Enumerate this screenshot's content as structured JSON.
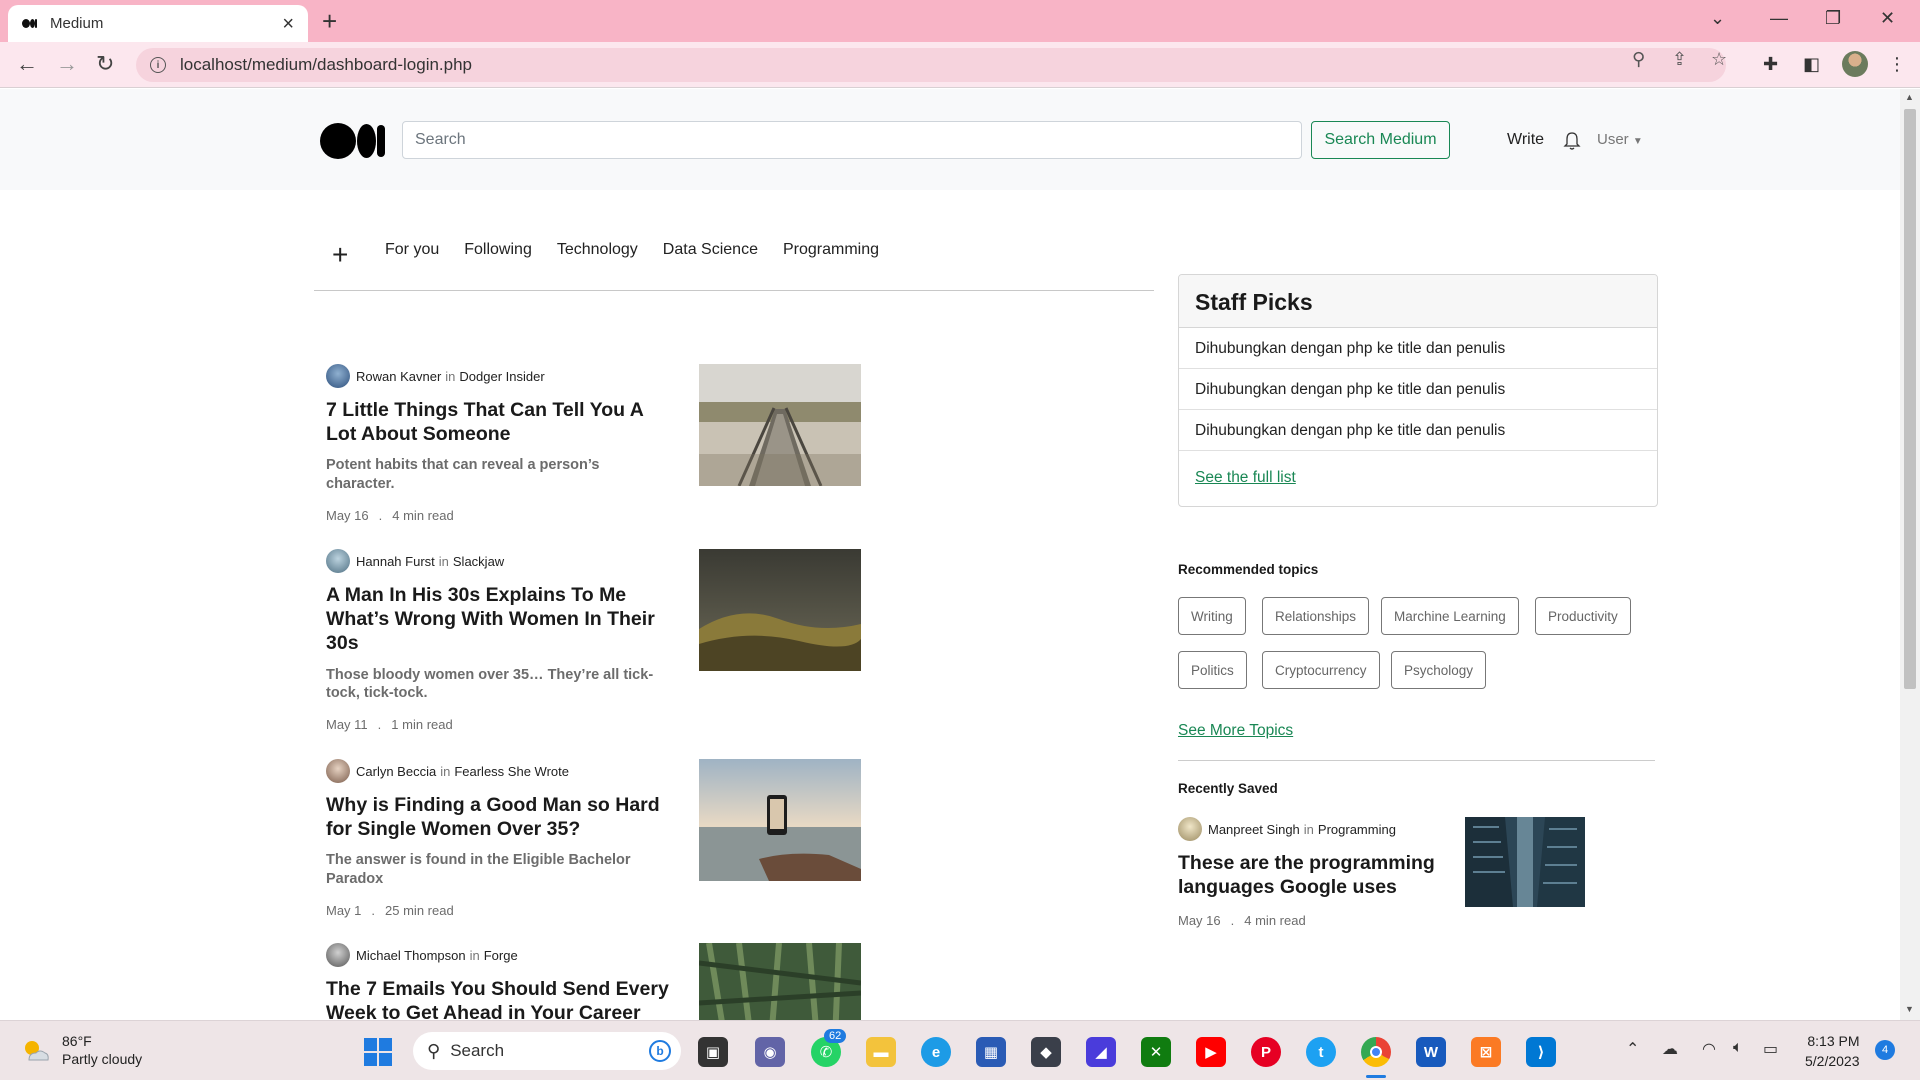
{
  "browser": {
    "tab_title": "Medium",
    "url": "localhost/medium/dashboard-login.php"
  },
  "header": {
    "search_placeholder": "Search",
    "search_button": "Search Medium",
    "write_label": "Write",
    "user_label": "User"
  },
  "topics_nav": [
    "For you",
    "Following",
    "Technology",
    "Data Science",
    "Programming"
  ],
  "articles": [
    {
      "author": "Rowan Kavner",
      "in": "in",
      "publication": "Dodger Insider",
      "title": "7 Little Things That Can Tell You A Lot About Someone",
      "subtitle": "Potent habits that can reveal a person’s character.",
      "date": "May 16",
      "dot": ".",
      "read_time": "4 min read"
    },
    {
      "author": "Hannah Furst",
      "in": "in",
      "publication": "Slackjaw",
      "title": "A Man In His 30s Explains To Me What’s Wrong With Women In Their 30s",
      "subtitle": "Those bloody women over 35… They’re all tick-tock, tick-tock.",
      "date": "May 11",
      "dot": ".",
      "read_time": "1 min read"
    },
    {
      "author": "Carlyn Beccia",
      "in": "in",
      "publication": "Fearless She Wrote",
      "title": "Why is Finding a Good Man so Hard for Single Women Over 35?",
      "subtitle": "The answer is found in the Eligible Bachelor Paradox",
      "date": "May 1",
      "dot": ".",
      "read_time": "25 min read"
    },
    {
      "author": "Michael Thompson",
      "in": "in",
      "publication": "Forge",
      "title": "The 7 Emails You Should Send Every Week to Get Ahead in Your Career"
    }
  ],
  "staff_picks": {
    "title": "Staff Picks",
    "items": [
      "Dihubungkan dengan php ke title dan penulis",
      "Dihubungkan dengan php ke title dan penulis",
      "Dihubungkan dengan php ke title dan penulis"
    ],
    "full_list_link": "See the full list"
  },
  "recommended": {
    "title": "Recommended topics",
    "chips": [
      "Writing",
      "Relationships",
      "Marchine Learning",
      "Productivity",
      "Politics",
      "Cryptocurrency",
      "Psychology"
    ],
    "more_link": "See More Topics"
  },
  "recently_saved": {
    "title": "Recently Saved",
    "author": "Manpreet Singh",
    "in": "in",
    "publication": "Programming",
    "article_title": "These are the programming languages Google uses",
    "date": "May 16",
    "dot": ".",
    "read_time": "4 min read"
  },
  "taskbar": {
    "temperature": "86°F",
    "weather": "Partly cloudy",
    "search_label": "Search",
    "whatsapp_badge": "62",
    "time": "8:13 PM",
    "date": "5/2/2023",
    "notifications": "4"
  },
  "colors": {
    "chrome_tab_strip": "#f8b4c6",
    "accent_green": "#198754",
    "taskbar_accent": "#1f7be0"
  }
}
